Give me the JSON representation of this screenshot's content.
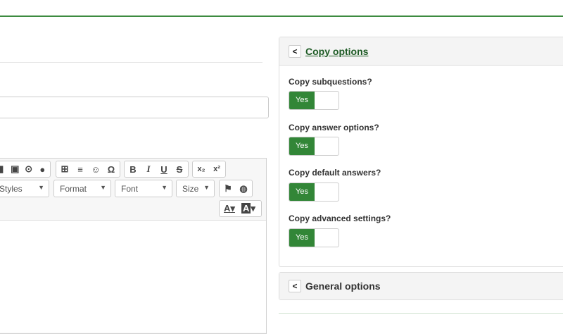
{
  "editor": {
    "toolbar": {
      "row1": [
        {
          "icon": "iframe-icon"
        },
        {
          "icon": "video-icon"
        },
        {
          "icon": "play-icon"
        },
        {
          "icon": "compass-icon"
        },
        {
          "icon": "table-icon"
        },
        {
          "icon": "horizontal-line-icon"
        },
        {
          "icon": "smiley-icon"
        },
        {
          "icon": "omega-icon",
          "glyph": "Ω"
        },
        {
          "icon": "bold-icon",
          "glyph": "B"
        },
        {
          "icon": "italic-icon",
          "glyph": "I"
        },
        {
          "icon": "underline-icon",
          "glyph": "U"
        },
        {
          "icon": "strikethrough-icon",
          "glyph": "S"
        },
        {
          "icon": "subscript-icon",
          "glyph": "x₂"
        },
        {
          "icon": "superscript-icon",
          "glyph": "x²"
        }
      ],
      "styles": "Styles",
      "format": "Format",
      "font": "Font",
      "size": "Size",
      "text_color_glyph": "A",
      "bg_color_glyph": "A"
    }
  },
  "copy_options": {
    "title": "Copy options",
    "items": [
      {
        "label": "Copy subquestions?",
        "value": "Yes"
      },
      {
        "label": "Copy answer options?",
        "value": "Yes"
      },
      {
        "label": "Copy default answers?",
        "value": "Yes"
      },
      {
        "label": "Copy advanced settings?",
        "value": "Yes"
      }
    ]
  },
  "general_options": {
    "title": "General options"
  },
  "colors": {
    "accent": "#328637",
    "link": "#1e5b25"
  }
}
